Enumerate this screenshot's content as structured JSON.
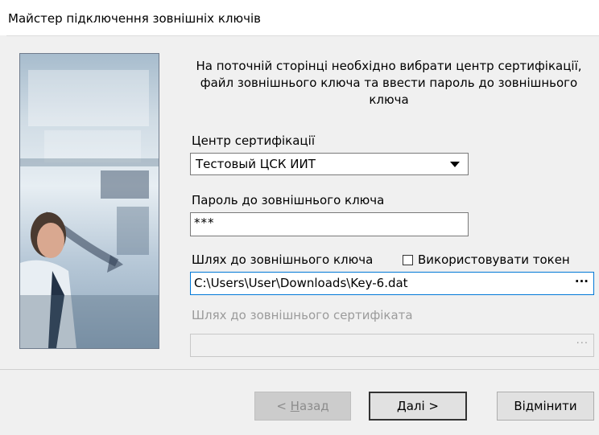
{
  "window": {
    "title": "Майстер підключення зовнішніх ключів"
  },
  "heading": "На поточній сторінці необхідно вибрати центр сертифікації, файл зовнішнього ключа та ввести пароль до зовнішнього ключа",
  "ca": {
    "label": "Центр сертифікації",
    "selected": "Тестовый ЦСК ИИТ"
  },
  "password": {
    "label": "Пароль до зовнішнього ключа",
    "value": "***"
  },
  "key_path": {
    "label": "Шлях до зовнішнього ключа",
    "use_token_label": "Використовувати токен",
    "use_token_checked": false,
    "value": "C:\\Users\\User\\Downloads\\Key-6.dat",
    "browse_label": "···"
  },
  "cert_path": {
    "label": "Шлях до зовнішнього сертифіката",
    "value": "",
    "browse_label": "···"
  },
  "buttons": {
    "back_prefix": "< ",
    "back_hotkey": "Н",
    "back_rest": "азад",
    "next_hotkey": "Д",
    "next_rest": "алі >",
    "cancel": "Відмінити"
  }
}
